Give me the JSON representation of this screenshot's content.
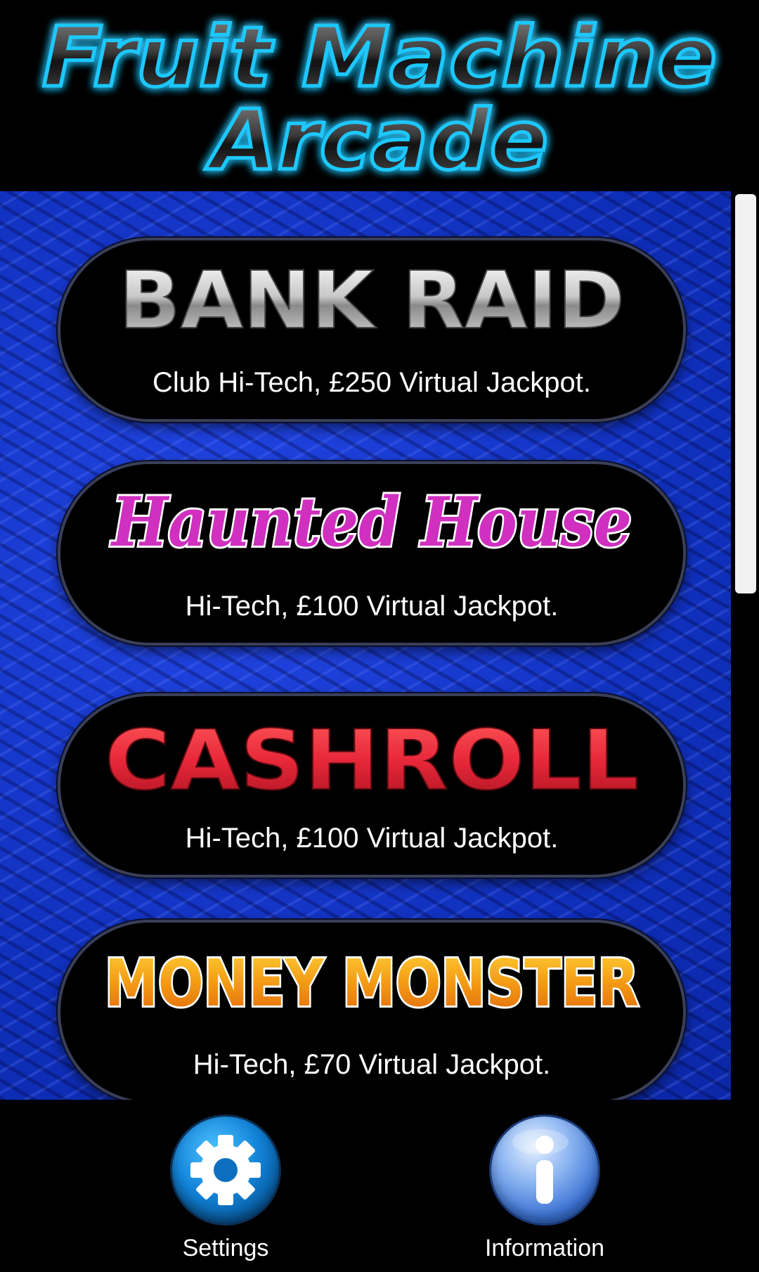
{
  "app": {
    "title_line1": "Fruit Machine",
    "title_line2": "Arcade"
  },
  "games": [
    {
      "name": "BANK RAID",
      "description": "Club Hi-Tech, £250 Virtual Jackpot.",
      "logo_color": "#d8d8d8"
    },
    {
      "name": "Haunted House",
      "description": "Hi-Tech, £100 Virtual Jackpot.",
      "logo_color": "#d02fc0"
    },
    {
      "name": "CASHROLL",
      "description": "Hi-Tech, £100 Virtual Jackpot.",
      "logo_color": "#e8283a"
    },
    {
      "name": "MONEY MONSTER",
      "description": "Hi-Tech, £70 Virtual Jackpot.",
      "logo_color": "#f39a14"
    }
  ],
  "bottom_nav": {
    "settings": {
      "label": "Settings",
      "icon": "gear-icon"
    },
    "information": {
      "label": "Information",
      "icon": "info-icon"
    }
  },
  "colors": {
    "background_blue": "#1434c8",
    "title_glow": "#1ec8ff"
  }
}
